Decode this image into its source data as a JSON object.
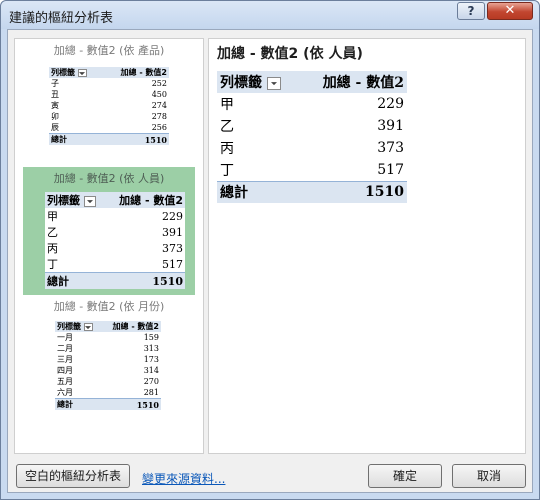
{
  "window": {
    "title": "建議的樞紐分析表",
    "help_label": "?",
    "close_label": "✕"
  },
  "thumbnails": [
    {
      "caption": "加總 - 數值2 (依 產品)",
      "header_row": "列標籤",
      "header_value": "加總 - 數值2",
      "rows": [
        {
          "label": "子",
          "value": "252"
        },
        {
          "label": "丑",
          "value": "450"
        },
        {
          "label": "寅",
          "value": "274"
        },
        {
          "label": "卯",
          "value": "278"
        },
        {
          "label": "辰",
          "value": "256"
        }
      ],
      "total_label": "總計",
      "total_value": "1510"
    },
    {
      "caption": "加總 - 數值2 (依 人員)",
      "header_row": "列標籤",
      "header_value": "加總 - 數值2",
      "rows": [
        {
          "label": "甲",
          "value": "229"
        },
        {
          "label": "乙",
          "value": "391"
        },
        {
          "label": "丙",
          "value": "373"
        },
        {
          "label": "丁",
          "value": "517"
        }
      ],
      "total_label": "總計",
      "total_value": "1510"
    },
    {
      "caption": "加總 - 數值2 (依 月份)",
      "header_row": "列標籤",
      "header_value": "加總 - 數值2",
      "rows": [
        {
          "label": "一月",
          "value": "159"
        },
        {
          "label": "二月",
          "value": "313"
        },
        {
          "label": "三月",
          "value": "173"
        },
        {
          "label": "四月",
          "value": "314"
        },
        {
          "label": "五月",
          "value": "270"
        },
        {
          "label": "六月",
          "value": "281"
        }
      ],
      "total_label": "總計",
      "total_value": "1510"
    }
  ],
  "selected_index": 1,
  "preview": {
    "caption": "加總 - 數值2 (依 人員)",
    "header_row": "列標籤",
    "header_value": "加總 - 數值2",
    "rows": [
      {
        "label": "甲",
        "value": "229"
      },
      {
        "label": "乙",
        "value": "391"
      },
      {
        "label": "丙",
        "value": "373"
      },
      {
        "label": "丁",
        "value": "517"
      }
    ],
    "total_label": "總計",
    "total_value": "1510"
  },
  "footer": {
    "blank_pivot_label": "空白的樞紐分析表",
    "change_source_label": "變更來源資料...",
    "ok_label": "確定",
    "cancel_label": "取消"
  }
}
